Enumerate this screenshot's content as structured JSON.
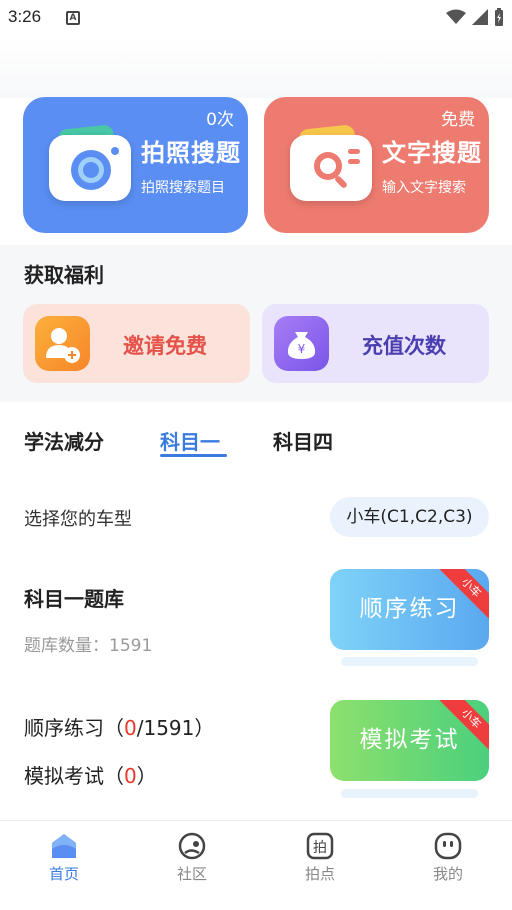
{
  "status_bar": {
    "time": "3:26",
    "notification_icon": "a-icon"
  },
  "search_cards": {
    "photo": {
      "badge": "0次",
      "title": "拍照搜题",
      "subtitle": "拍照搜索题目",
      "color": "#5a8ef2"
    },
    "text": {
      "badge": "免费",
      "title": "文字搜题",
      "subtitle": "输入文字搜索",
      "color": "#ee7b6f"
    }
  },
  "benefits": {
    "title": "获取福利",
    "invite_label": "邀请免费",
    "recharge_label": "充值次数"
  },
  "tabs": [
    "学法减分",
    "科目一",
    "科目四"
  ],
  "active_tab": "科目一",
  "car_type": {
    "label": "选择您的车型",
    "value": "小车(C1,C2,C3)"
  },
  "question_bank": {
    "title": "科目一题库",
    "count_label": "题库数量：",
    "count": "1591"
  },
  "stats": {
    "sequential": {
      "prefix": "顺序练习（",
      "done": "0",
      "suffix": "/1591）"
    },
    "exam": {
      "prefix": "模拟考试（",
      "done": "0",
      "suffix": "）"
    }
  },
  "buttons": {
    "sequential": {
      "label": "顺序练习",
      "ribbon": "小车"
    },
    "exam": {
      "label": "模拟考试",
      "ribbon": "小车"
    }
  },
  "bottom_nav": [
    {
      "label": "首页",
      "icon": "home-icon",
      "active": true
    },
    {
      "label": "社区",
      "icon": "community-icon",
      "active": false
    },
    {
      "label": "拍点",
      "icon": "photo-point-icon",
      "active": false
    },
    {
      "label": "我的",
      "icon": "profile-icon",
      "active": false
    }
  ],
  "colors": {
    "accent": "#3a7be0",
    "highlight_red": "#e8392b"
  }
}
